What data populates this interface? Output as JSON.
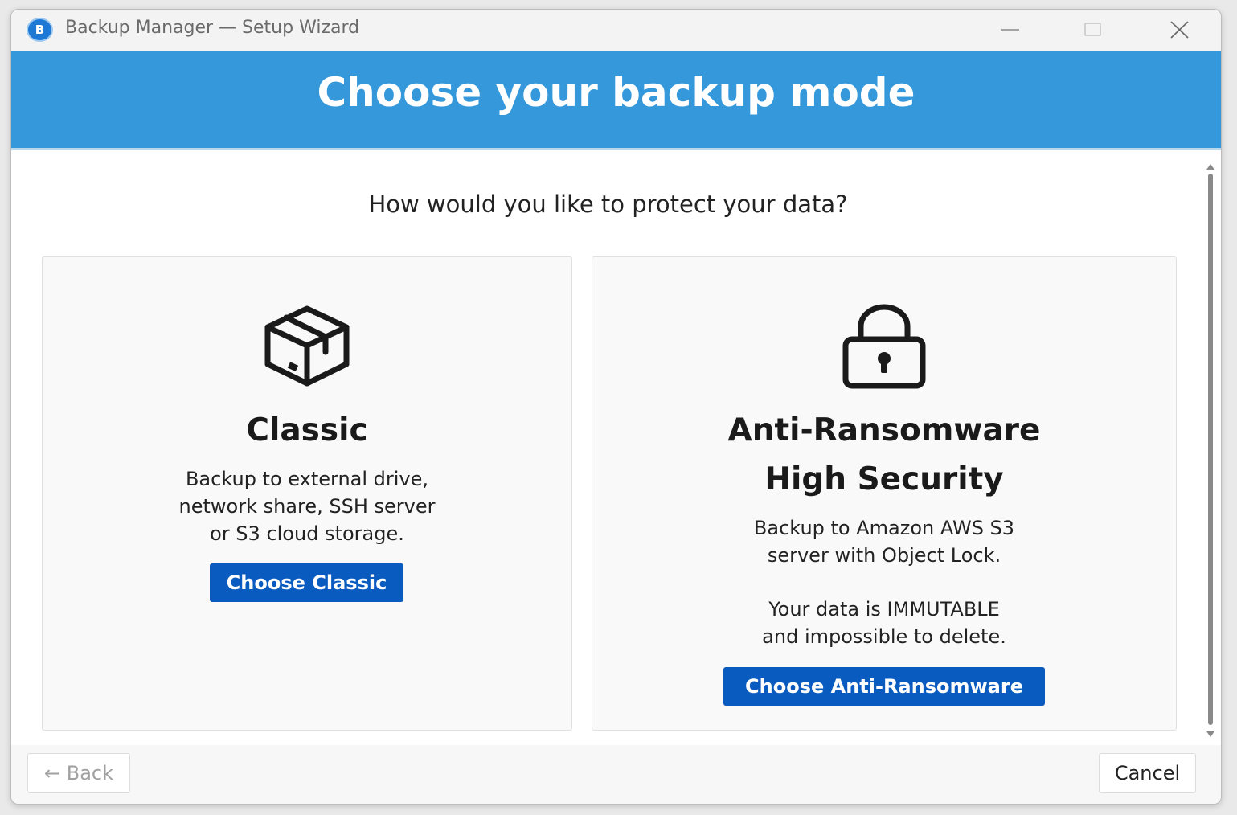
{
  "window": {
    "app_icon_letter": "B",
    "title": "Backup Manager — Setup Wizard"
  },
  "banner": {
    "title": "Choose your backup mode"
  },
  "main": {
    "question": "How would you like to protect your data?",
    "classic": {
      "icon": "box-icon",
      "heading": "Classic",
      "description_lines": [
        "Backup to external drive,",
        "network share, SSH server",
        "or S3 cloud storage."
      ],
      "button_label": "Choose Classic"
    },
    "ransomware": {
      "icon": "padlock-icon",
      "heading_lines": [
        "Anti-Ransomware",
        "High Security"
      ],
      "description_lines": [
        "Backup to Amazon AWS S3",
        "server with Object Lock."
      ],
      "note_lines": [
        "Your data is IMMUTABLE",
        "and impossible to delete."
      ],
      "button_label": "Choose Anti-Ransomware"
    }
  },
  "footer": {
    "back_label": "← Back",
    "cancel_label": "Cancel"
  },
  "colors": {
    "banner": "#3498db",
    "primary_button": "#0a5bc0"
  }
}
